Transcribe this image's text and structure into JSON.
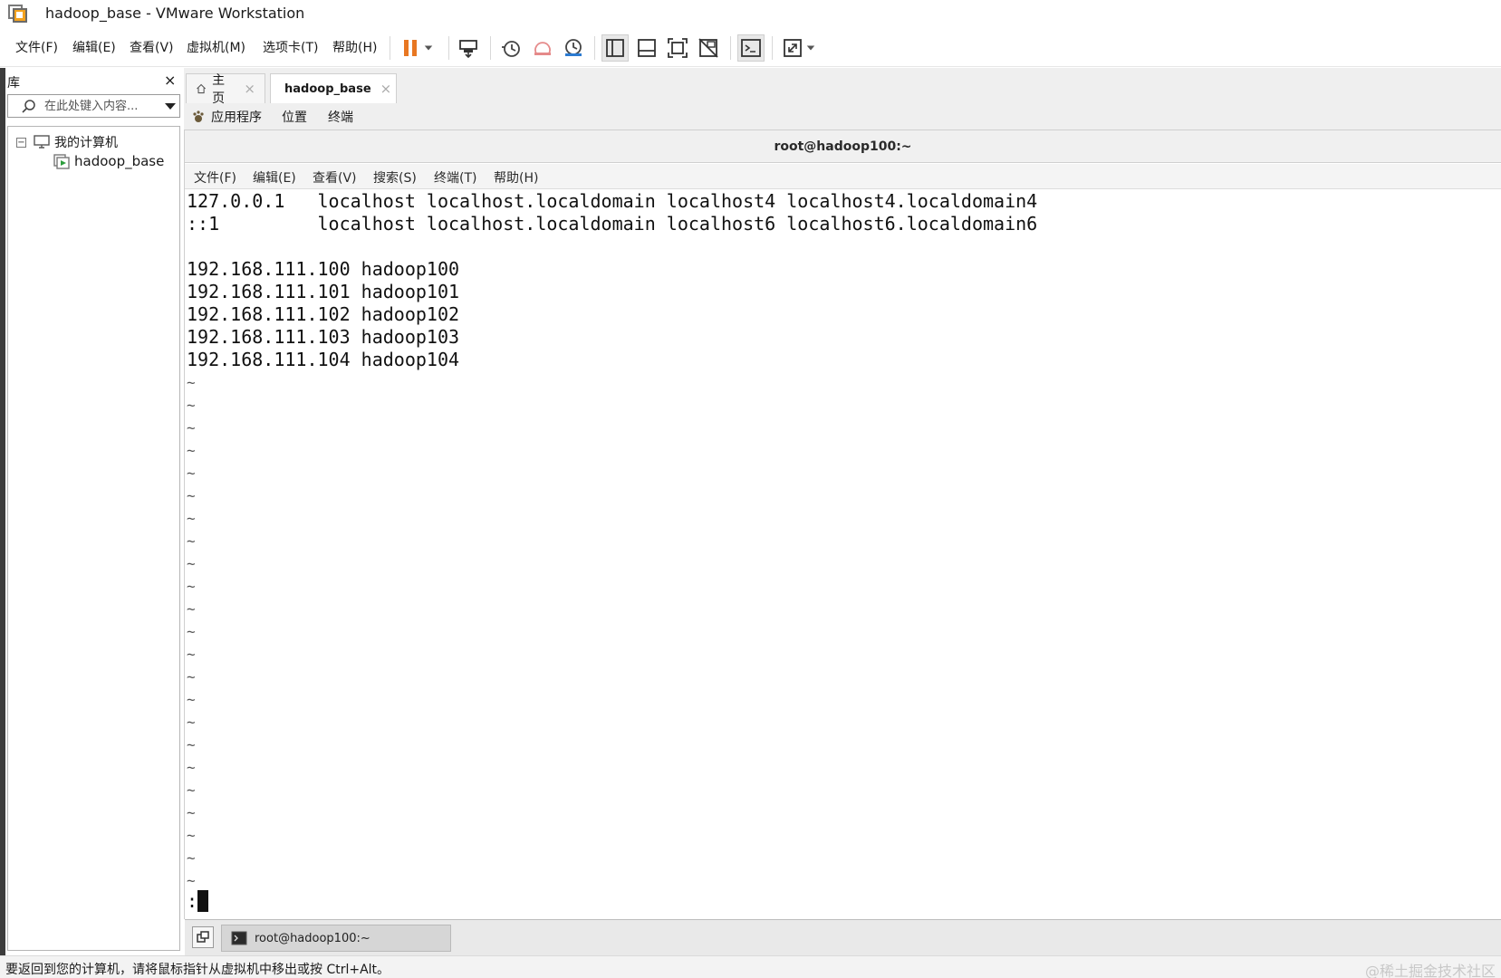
{
  "window": {
    "title": "hadoop_base - VMware Workstation"
  },
  "menu": {
    "file": "文件(F)",
    "edit": "编辑(E)",
    "view": "查看(V)",
    "vm": "虚拟机(M)",
    "tabs": "选项卡(T)",
    "help": "帮助(H)"
  },
  "toolbar": {
    "icons": [
      "pause-icon",
      "dropdown-icon",
      "send-keys-icon",
      "snapshot-take-icon",
      "snapshot-revert-icon",
      "snapshot-manager-icon",
      "show-library-icon",
      "show-thumbnail-icon",
      "fullscreen-icon",
      "unity-icon",
      "console-view-icon",
      "stretch-icon"
    ]
  },
  "library": {
    "title": "库",
    "close": "×",
    "search_placeholder": "在此处键入内容...",
    "tree": {
      "root_expander": "−",
      "root": "我的计算机",
      "child": "hadoop_base"
    }
  },
  "tabs": {
    "home": "主页",
    "vm": "hadoop_base",
    "close": "×"
  },
  "subtoolbar": {
    "apps": "应用程序",
    "places": "位置",
    "terminal": "终端"
  },
  "terminal": {
    "title": "root@hadoop100:~",
    "menu": {
      "file": "文件(F)",
      "edit": "编辑(E)",
      "view": "查看(V)",
      "search": "搜索(S)",
      "terminal": "终端(T)",
      "help": "帮助(H)"
    },
    "lines": [
      "127.0.0.1   localhost localhost.localdomain localhost4 localhost4.localdomain4",
      "::1         localhost localhost.localdomain localhost6 localhost6.localdomain6",
      "",
      "192.168.111.100 hadoop100",
      "192.168.111.101 hadoop101",
      "192.168.111.102 hadoop102",
      "192.168.111.103 hadoop103",
      "192.168.111.104 hadoop104"
    ],
    "tilde": "~",
    "prompt": ":"
  },
  "guest_taskbar": {
    "task_label": "root@hadoop100:~"
  },
  "status": {
    "message": "要返回到您的计算机，请将鼠标指针从虚拟机中移出或按 Ctrl+Alt。",
    "watermark": "@稀土掘金技术社区"
  }
}
